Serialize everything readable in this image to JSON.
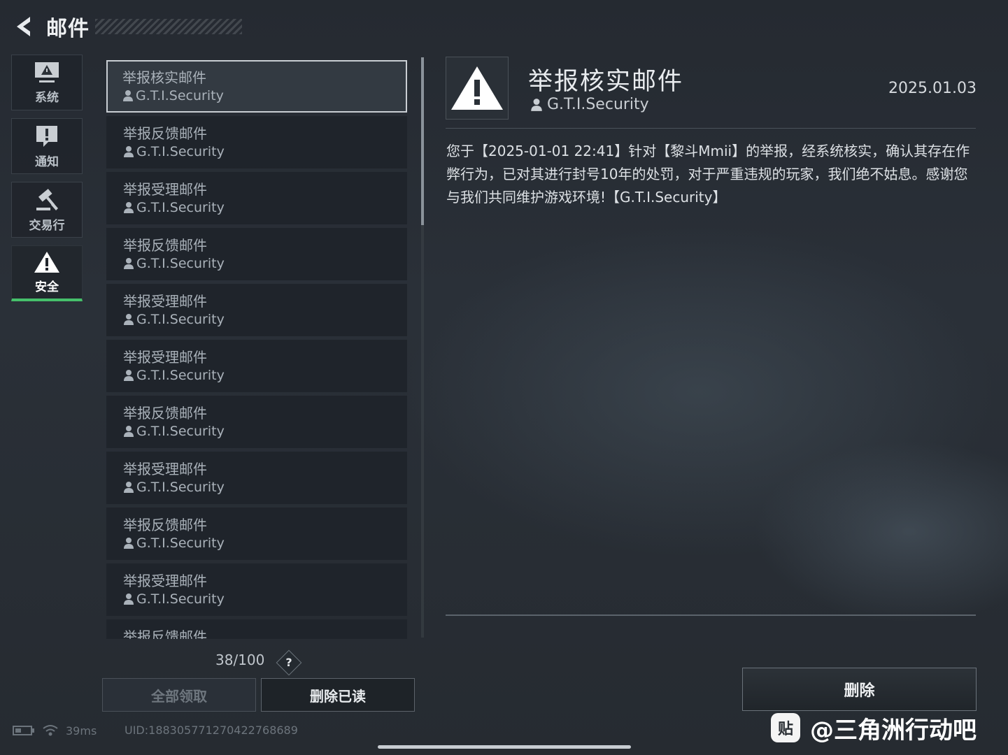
{
  "header": {
    "title": "邮件"
  },
  "nav": {
    "items": [
      {
        "label": "系统",
        "icon": "monitor-warning-icon"
      },
      {
        "label": "通知",
        "icon": "notice-icon"
      },
      {
        "label": "交易行",
        "icon": "gavel-icon"
      },
      {
        "label": "安全",
        "icon": "warning-triangle-icon",
        "active": true
      }
    ]
  },
  "mail_list": {
    "items": [
      {
        "subject": "举报核实邮件",
        "sender": "G.T.I.Security",
        "selected": true
      },
      {
        "subject": "举报反馈邮件",
        "sender": "G.T.I.Security"
      },
      {
        "subject": "举报受理邮件",
        "sender": "G.T.I.Security"
      },
      {
        "subject": "举报反馈邮件",
        "sender": "G.T.I.Security"
      },
      {
        "subject": "举报受理邮件",
        "sender": "G.T.I.Security"
      },
      {
        "subject": "举报受理邮件",
        "sender": "G.T.I.Security"
      },
      {
        "subject": "举报反馈邮件",
        "sender": "G.T.I.Security"
      },
      {
        "subject": "举报受理邮件",
        "sender": "G.T.I.Security"
      },
      {
        "subject": "举报反馈邮件",
        "sender": "G.T.I.Security"
      },
      {
        "subject": "举报受理邮件",
        "sender": "G.T.I.Security"
      },
      {
        "subject": "举报反馈邮件",
        "sender": ""
      }
    ],
    "count": "38/100",
    "help_label": "?"
  },
  "buttons": {
    "claim_all": "全部领取",
    "delete_read": "删除已读",
    "delete": "删除"
  },
  "detail": {
    "title": "举报核实邮件",
    "sender": "G.T.I.Security",
    "date": "2025.01.03",
    "body": "您于【2025-01-01 22:41】针对【黎斗Mmii】的举报，经系统核实，确认其存在作弊行为，已对其进行封号10年的处罚，对于严重违规的玩家，我们绝不姑息。感谢您与我们共同维护游戏环境!【G.T.I.Security】"
  },
  "status": {
    "ping": "39ms",
    "uid": "UID:1883057712704227686​89"
  },
  "watermark": {
    "logo": "贴",
    "text": "@三角洲行动吧"
  },
  "colors": {
    "accent_green": "#46c06b",
    "background": "#262b31"
  }
}
